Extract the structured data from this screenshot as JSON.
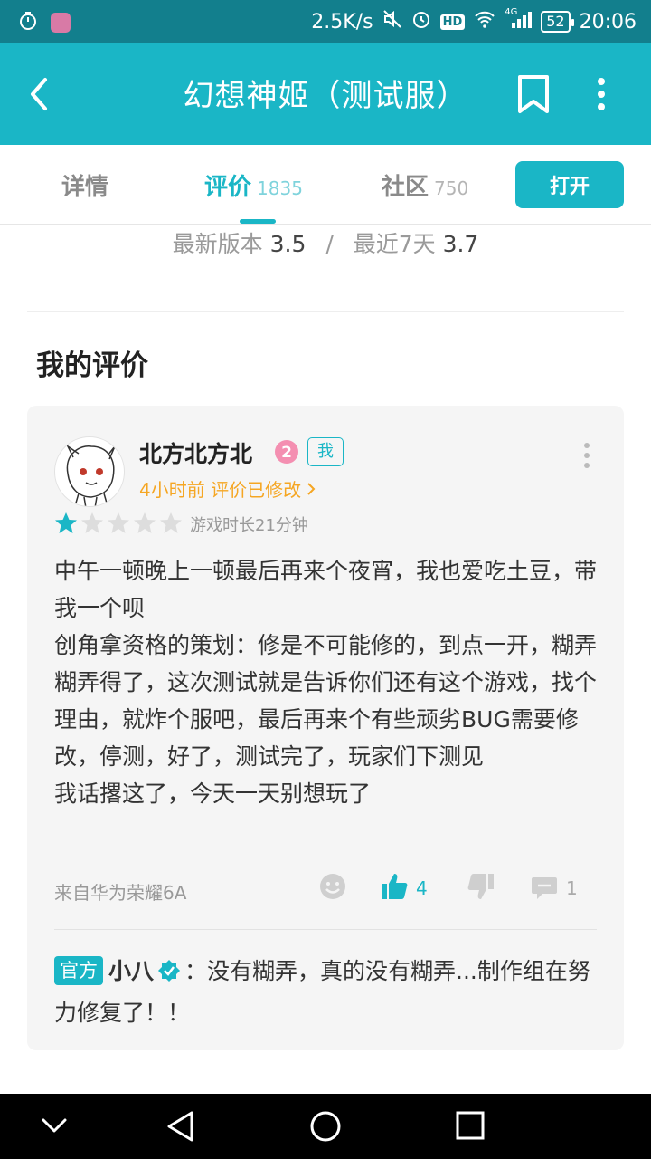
{
  "status_bar": {
    "net_speed": "2.5K/s",
    "hd": "HD",
    "signal_label": "4G",
    "battery": "52",
    "time": "20:06"
  },
  "app_bar": {
    "title": "幻想神姬（测试服）",
    "back_icon": "back-arrow-icon",
    "bookmark_icon": "bookmark-icon",
    "more_icon": "more-vertical-icon"
  },
  "tabs": {
    "details": {
      "label": "详情"
    },
    "reviews": {
      "label": "评价",
      "count": "1835"
    },
    "community": {
      "label": "社区",
      "count": "750"
    },
    "open_button": "打开"
  },
  "scores": {
    "latest_label": "最新版本",
    "latest_value": "3.5",
    "separator": "/",
    "recent_label": "最近7天",
    "recent_value": "3.7"
  },
  "my_review": {
    "section_title": "我的评价",
    "user": {
      "name": "北方北方北",
      "level": "2",
      "me_badge": "我"
    },
    "meta": "4小时前 评价已修改",
    "rating": 1,
    "rating_max": 5,
    "playtime": "游戏时长21分钟",
    "body": [
      "中午一顿晚上一顿最后再来个夜宵，我也爱吃土豆，带我一个呗",
      "创角拿资格的策划：修是不可能修的，到点一开，糊弄糊弄得了，这次测试就是告诉你们还有这个游戏，找个理由，就炸个服吧，最后再来个有些顽劣BUG需要修改，停测，好了，测试完了，玩家们下测见",
      "我话撂这了，今天一天别想玩了"
    ],
    "device": "来自华为荣耀6A",
    "likes": "4",
    "comments": "1",
    "accent_color": "#1ab6c6",
    "meta_color": "#f5a623",
    "official_reply": {
      "tag": "官方",
      "name": "小八",
      "text": "：没有糊弄，真的没有糊弄...制作组在努力修复了！！"
    }
  }
}
